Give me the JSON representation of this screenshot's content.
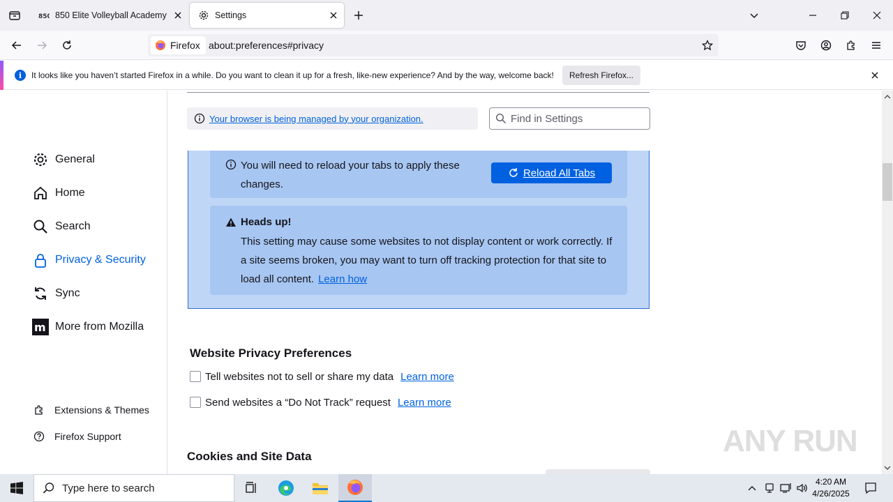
{
  "tabs": [
    {
      "title": "850 Elite Volleyball Academy"
    },
    {
      "title": "Settings"
    }
  ],
  "navbar": {
    "identity_label": "Firefox",
    "url": "about:preferences#privacy"
  },
  "notification": {
    "message": "It looks like you haven’t started Firefox in a while. Do you want to clean it up for a fresh, like-new experience? And by the way, welcome back!",
    "button_label": "Refresh Firefox..."
  },
  "sidebar": {
    "categories": [
      {
        "label": "General",
        "icon": "gear-icon"
      },
      {
        "label": "Home",
        "icon": "home-icon"
      },
      {
        "label": "Search",
        "icon": "search-icon"
      },
      {
        "label": "Privacy & Security",
        "icon": "lock-icon",
        "selected": true
      },
      {
        "label": "Sync",
        "icon": "sync-icon"
      },
      {
        "label": "More from Mozilla",
        "icon": "mozilla-icon"
      }
    ],
    "footer": [
      {
        "label": "Extensions & Themes",
        "icon": "puzzle-icon"
      },
      {
        "label": "Firefox Support",
        "icon": "help-icon"
      }
    ]
  },
  "main": {
    "policy_link": "Your browser is being managed by your organization.",
    "find_placeholder": "Find in Settings",
    "reload_notice": "You will need to reload your tabs to apply these changes.",
    "reload_button": "Reload All Tabs",
    "headsup_title": "Heads up!",
    "headsup_body": "This setting may cause some websites to not display content or work correctly. If a site seems broken, you may want to turn off tracking protection for that site to load all content.",
    "headsup_link": "Learn how",
    "privacy_prefs_title": "Website Privacy Preferences",
    "checkboxes": [
      {
        "label": "Tell websites not to sell or share my data",
        "link": "Learn more",
        "checked": false
      },
      {
        "label": "Send websites a “Do Not Track” request",
        "link": "Learn more",
        "checked": false
      }
    ],
    "cookies_title": "Cookies and Site Data"
  },
  "watermark": "ANY RUN",
  "taskbar": {
    "search_placeholder": "Type here to search",
    "time": "4:20 AM",
    "date": "4/26/2025"
  },
  "colors": {
    "accent": "#0061e0",
    "etp_box_bg": "#bfd6f6",
    "notice_bg": "#a7c6f2"
  }
}
